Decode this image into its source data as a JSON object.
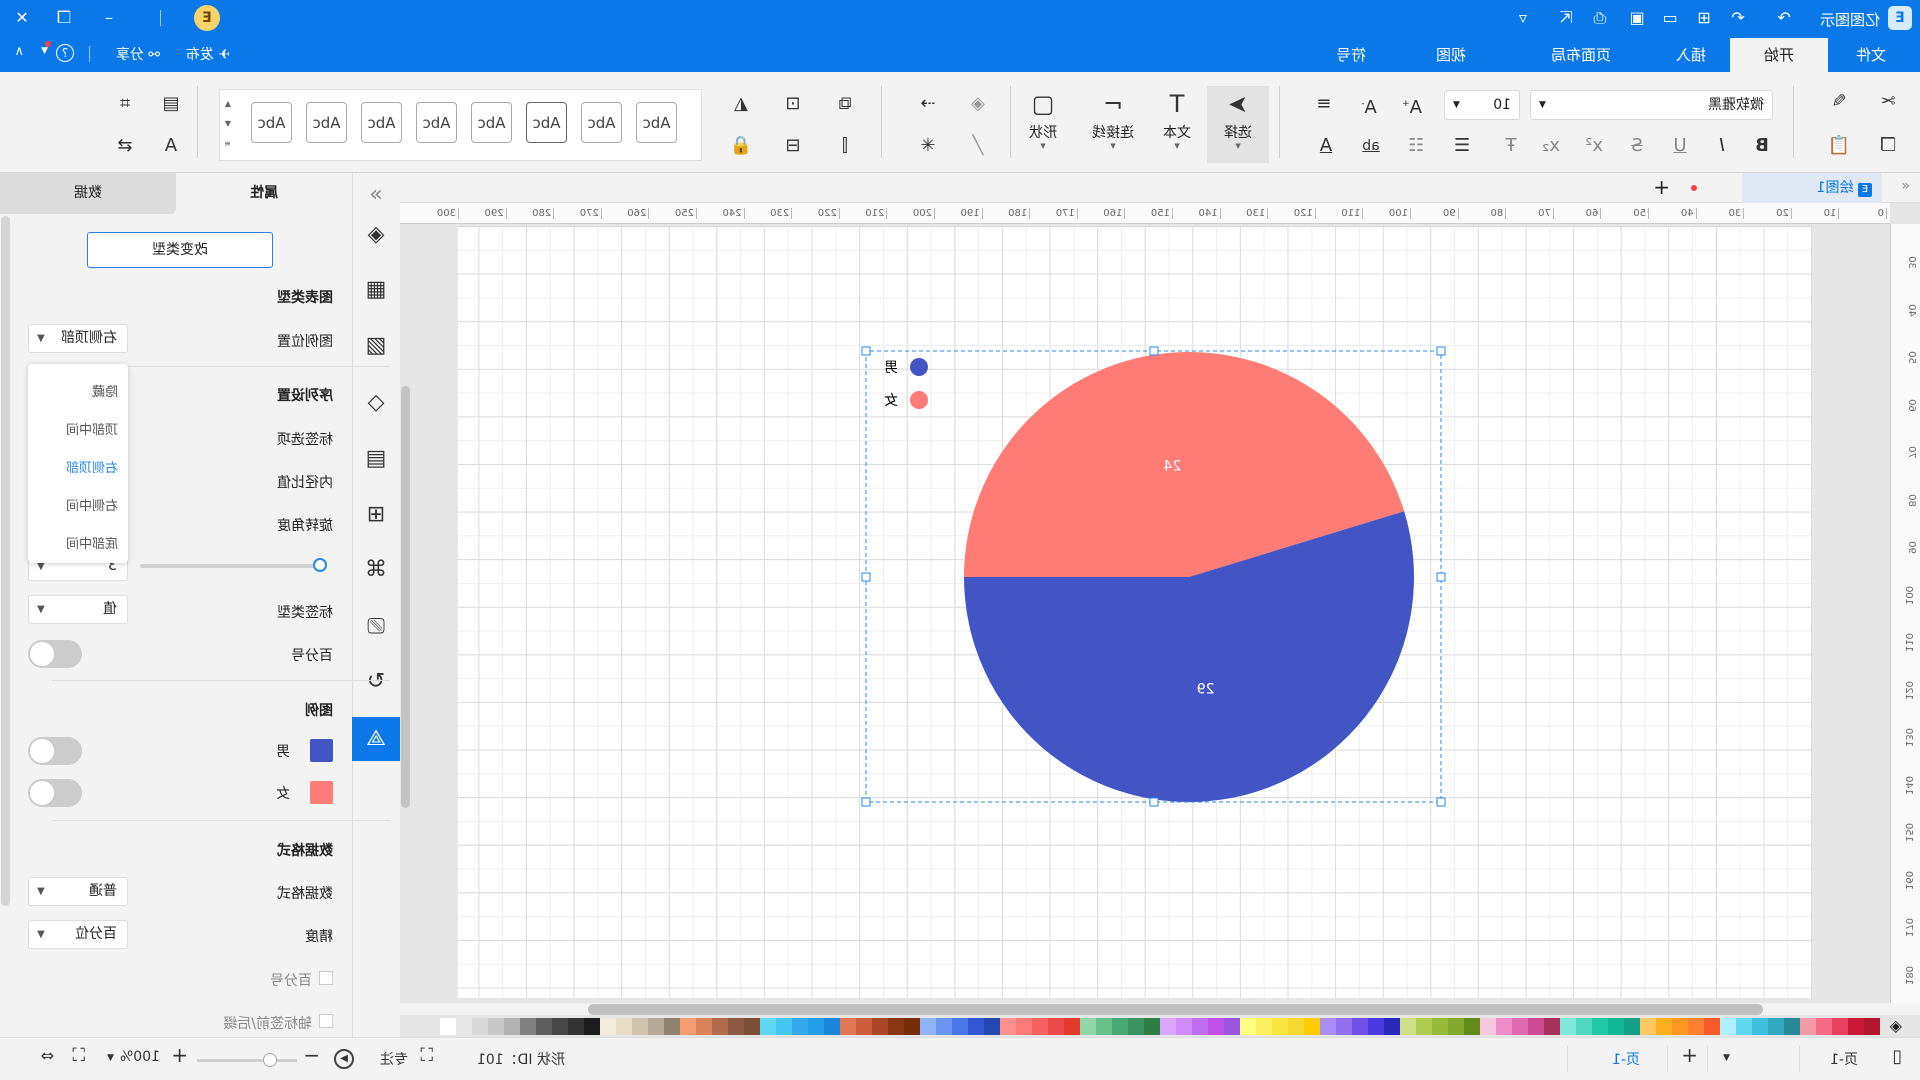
{
  "app": {
    "title": "亿图图示",
    "quick_access": [
      "redo-icon",
      "undo-icon",
      "new-icon",
      "open-icon",
      "save-icon",
      "print-icon",
      "export-icon",
      "more-icon"
    ]
  },
  "window": {
    "minimize": "–",
    "restore": "❐",
    "close": "✕",
    "badge": "E"
  },
  "ribbon_tabs": [
    "文件",
    "开始",
    "插入",
    "页面布局",
    "视图",
    "符号"
  ],
  "active_tab": "开始",
  "top_actions": {
    "publish": "发布",
    "share": "分享"
  },
  "toolbar": {
    "font_family": "微软雅黑",
    "font_size": "10",
    "tools": [
      {
        "label": "选择",
        "icon": "pointer-icon"
      },
      {
        "label": "文本",
        "icon": "text-icon"
      },
      {
        "label": "连接线",
        "icon": "connector-icon"
      },
      {
        "label": "形状",
        "icon": "shape-icon"
      }
    ],
    "style_gallery": [
      "Abc",
      "Abc",
      "Abc",
      "Abc",
      "Abc",
      "Abc",
      "Abc",
      "Abc"
    ]
  },
  "document": {
    "tab": "绘图1"
  },
  "ruler": {
    "top": [
      0,
      10,
      20,
      30,
      40,
      50,
      60,
      70,
      80,
      90,
      100,
      110,
      120,
      130,
      140,
      150,
      160,
      170,
      180,
      190,
      200,
      210,
      220,
      230,
      240,
      250,
      260,
      270,
      280,
      290,
      300
    ],
    "left": [
      30,
      40,
      50,
      60,
      70,
      80,
      90,
      100,
      110,
      120,
      130,
      140,
      150,
      160,
      170,
      180
    ]
  },
  "chart_data": {
    "type": "pie",
    "categories": [
      "男",
      "女"
    ],
    "values": [
      29,
      24
    ],
    "colors": [
      "#4355c4",
      "#ff7b75"
    ],
    "legend": "top-left",
    "data_labels": [
      "29",
      "24"
    ]
  },
  "panel": {
    "tabs": [
      "属性",
      "数据"
    ],
    "change_type": "改变类型",
    "chart_type": "图表类型",
    "legend_position_label": "图例位置",
    "legend_position_value": "右侧顶部",
    "legend_position_options": [
      "隐藏",
      "顶部中间",
      "右侧顶部",
      "右侧中间",
      "底部中间"
    ],
    "series_settings": "序列设置",
    "label_options": "标签选项",
    "inner_radius": "内径比值",
    "rotation": "旋转角度",
    "rotation_value": "3",
    "label_type_label": "标签类型",
    "label_type_value": "值",
    "percent_label": "百分号",
    "percent_on": false,
    "legend_title": "图例",
    "legend_items": [
      {
        "name": "男",
        "color": "#4355c4",
        "on": false
      },
      {
        "name": "女",
        "color": "#ff7b75",
        "on": false
      }
    ],
    "data_format_title": "数据格式",
    "data_format_label": "数据格式",
    "data_format_value": "普通",
    "precision_label": "精度",
    "precision_value": "百分位",
    "percent_checkbox": "百分号",
    "axis_affix_checkbox": "轴标签前/后缀"
  },
  "status": {
    "page_tab": "页-1",
    "page_name": "页-1",
    "shape_id": "形状 ID：101",
    "focus": "专注",
    "zoom": "100%"
  },
  "palette": [
    "#ffffff",
    "#e8e8e8",
    "#d9d9d9",
    "#c8c8c8",
    "#b3b3b3",
    "#808080",
    "#5e5e5e",
    "#474747",
    "#333333",
    "#1c1c1c",
    "#f2ecdc",
    "#e6dcc8",
    "#cfc4ad",
    "#b5aa98",
    "#8f8270",
    "#f59e71",
    "#d9835a",
    "#b36b4d",
    "#8c5a42",
    "#7a4f36",
    "#5fd8f5",
    "#45c5f2",
    "#33a8ec",
    "#259de8",
    "#1a86d9",
    "#e07858",
    "#cc5e3d",
    "#a84626",
    "#8a3614",
    "#752d0a",
    "#8fb4f5",
    "#6b95f0",
    "#4a76e8",
    "#3157d1",
    "#2448b0",
    "#ff9090",
    "#ff7a7a",
    "#f56060",
    "#eb4a4a",
    "#e33a2e",
    "#8fd6a8",
    "#66c08a",
    "#4aa874",
    "#3a9460",
    "#2e7d45",
    "#dca6ff",
    "#d08cfa",
    "#c06ef0",
    "#c050e8",
    "#9b55e0",
    "#ffff80",
    "#fbf060",
    "#f7e640",
    "#f5d830",
    "#ffcc00",
    "#a98cf5",
    "#9070ee",
    "#7050e8",
    "#4a3ae0",
    "#2a28b8",
    "#d0e088",
    "#b0cc50",
    "#98b83a",
    "#84a82e",
    "#648a1a",
    "#f5c8e0",
    "#f08cc8",
    "#e06ab0",
    "#cc4c94",
    "#a8305c",
    "#80e8d8",
    "#50d8c0",
    "#20c8a8",
    "#10b896",
    "#12a088",
    "#ffc860",
    "#ffb020",
    "#ff9820",
    "#ff8030",
    "#f55a28",
    "#aef0ff",
    "#60d8f0",
    "#40c0dc",
    "#30a8c0",
    "#288898",
    "#f59aa8",
    "#f56a84",
    "#e84060",
    "#cc1838",
    "#b01830"
  ],
  "accent": "#0a78e8"
}
